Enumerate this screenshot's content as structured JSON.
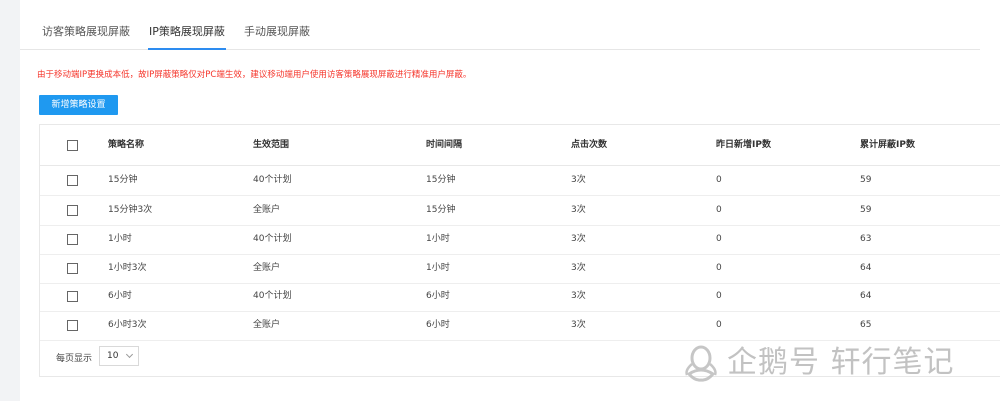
{
  "tabs": [
    {
      "label": "访客策略展现屏蔽",
      "active": false
    },
    {
      "label": "IP策略展现屏蔽",
      "active": true
    },
    {
      "label": "手动展现屏蔽",
      "active": false
    }
  ],
  "notice": "由于移动端IP更换成本低，故IP屏蔽策略仅对PC端生效，建议移动端用户使用访客策略展现屏蔽进行精准用户屏蔽。",
  "add_button_label": "新增策略设置",
  "table": {
    "headers": {
      "name": "策略名称",
      "scope": "生效范围",
      "interval": "时间间隔",
      "clicks": "点击次数",
      "new_ip": "昨日新增IP数",
      "total_ip": "累计屏蔽IP数"
    },
    "rows": [
      {
        "name": "15分钟",
        "scope": "40个计划",
        "interval": "15分钟",
        "clicks": "3次",
        "new_ip": "0",
        "total_ip": "59"
      },
      {
        "name": "15分钟3次",
        "scope": "全账户",
        "interval": "15分钟",
        "clicks": "3次",
        "new_ip": "0",
        "total_ip": "59"
      },
      {
        "name": "1小时",
        "scope": "40个计划",
        "interval": "1小时",
        "clicks": "3次",
        "new_ip": "0",
        "total_ip": "63"
      },
      {
        "name": "1小时3次",
        "scope": "全账户",
        "interval": "1小时",
        "clicks": "3次",
        "new_ip": "0",
        "total_ip": "64"
      },
      {
        "name": "6小时",
        "scope": "40个计划",
        "interval": "6小时",
        "clicks": "3次",
        "new_ip": "0",
        "total_ip": "64"
      },
      {
        "name": "6小时3次",
        "scope": "全账户",
        "interval": "6小时",
        "clicks": "3次",
        "new_ip": "0",
        "total_ip": "65"
      }
    ]
  },
  "pagination": {
    "label": "每页显示",
    "page_size": "10"
  },
  "watermark": {
    "text": "企鹅号 轩行笔记",
    "icon": "penguin-logo-icon"
  },
  "colors": {
    "accent": "#1f99f0",
    "active_tab_underline": "#2d8cf0",
    "notice": "#f5352b"
  }
}
